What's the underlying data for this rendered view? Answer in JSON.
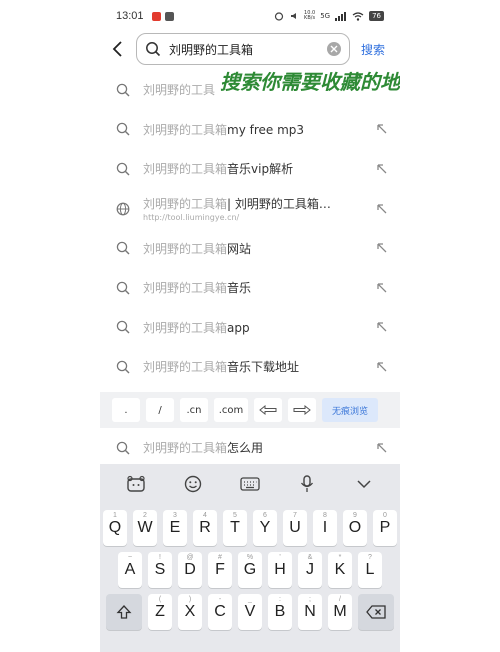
{
  "status": {
    "time": "13:01",
    "net_speed": "10.0\nKB/s",
    "signal": "5G",
    "battery": "76"
  },
  "search": {
    "query": "刘明野的工具箱",
    "button": "搜索"
  },
  "banner": "搜索你需要收藏的地址",
  "suggestions": [
    {
      "prefix": "刘明野的工具",
      "suffix": ""
    },
    {
      "prefix": "刘明野的工具箱",
      "suffix": "my free mp3"
    },
    {
      "prefix": "刘明野的工具箱",
      "suffix": "音乐vip解析"
    },
    {
      "prefix": "刘明野的工具箱",
      "middle": "| 刘明野的工具箱…",
      "url": "http://tool.liumingye.cn/"
    },
    {
      "prefix": "刘明野的工具箱",
      "suffix": "网站"
    },
    {
      "prefix": "刘明野的工具箱",
      "suffix": "音乐"
    },
    {
      "prefix": "刘明野的工具箱",
      "suffix": "app"
    },
    {
      "prefix": "刘明野的工具箱",
      "suffix": "音乐下载地址"
    },
    {
      "prefix": "刘明野的工具箱",
      "suffix": "怎么用"
    }
  ],
  "url_bar": {
    "keys": [
      ".",
      "/",
      ".cn",
      ".com"
    ],
    "incognito": "无痕浏览"
  },
  "keyboard": {
    "row1": [
      {
        "k": "Q",
        "s": "1"
      },
      {
        "k": "W",
        "s": "2"
      },
      {
        "k": "E",
        "s": "3"
      },
      {
        "k": "R",
        "s": "4"
      },
      {
        "k": "T",
        "s": "5"
      },
      {
        "k": "Y",
        "s": "6"
      },
      {
        "k": "U",
        "s": "7"
      },
      {
        "k": "I",
        "s": "8"
      },
      {
        "k": "O",
        "s": "9"
      },
      {
        "k": "P",
        "s": "0"
      }
    ],
    "row2": [
      {
        "k": "A",
        "s": "~"
      },
      {
        "k": "S",
        "s": "!"
      },
      {
        "k": "D",
        "s": "@"
      },
      {
        "k": "F",
        "s": "#"
      },
      {
        "k": "G",
        "s": "%"
      },
      {
        "k": "H",
        "s": "'"
      },
      {
        "k": "J",
        "s": "&"
      },
      {
        "k": "K",
        "s": "*"
      },
      {
        "k": "L",
        "s": "?"
      }
    ],
    "row3": [
      {
        "k": "Z",
        "s": "("
      },
      {
        "k": "X",
        "s": ")"
      },
      {
        "k": "C",
        "s": "-"
      },
      {
        "k": "V",
        "s": "_"
      },
      {
        "k": "B",
        "s": ":"
      },
      {
        "k": "N",
        "s": ";"
      },
      {
        "k": "M",
        "s": "/"
      }
    ]
  }
}
